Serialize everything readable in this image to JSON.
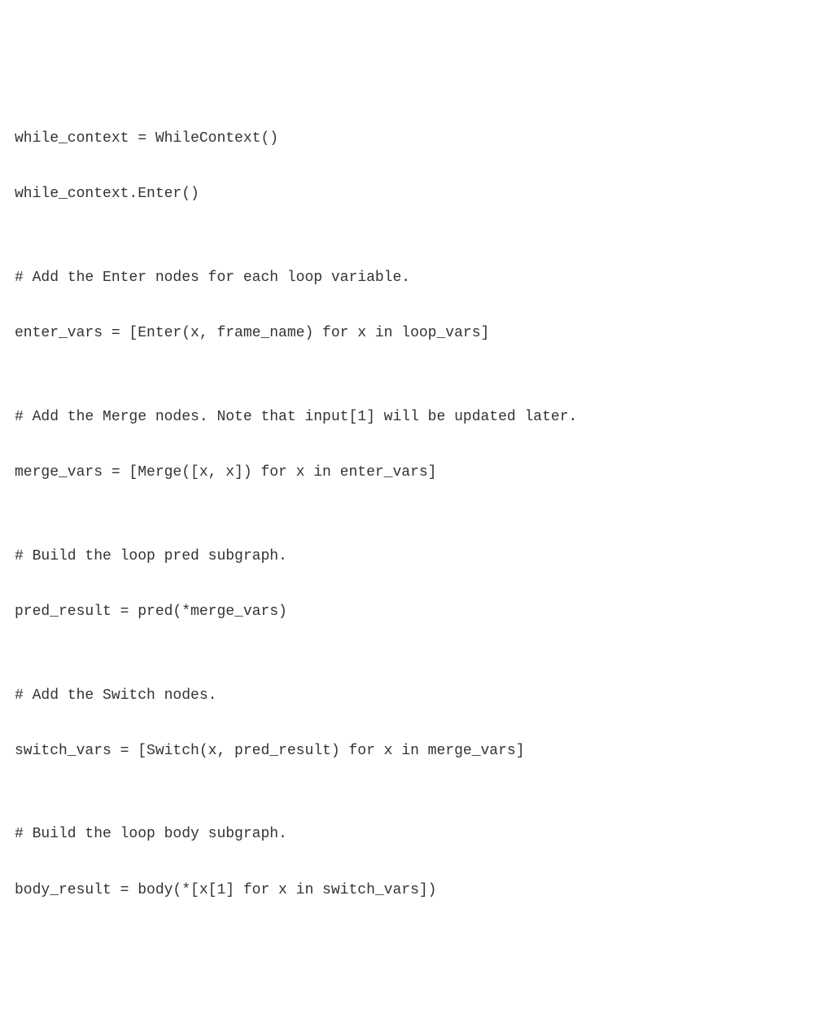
{
  "lines": [
    "while_context = WhileContext()",
    "while_context.Enter()",
    "",
    "# Add the Enter nodes for each loop variable.",
    "enter_vars = [Enter(x, frame_name) for x in loop_vars]",
    "",
    "# Add the Merge nodes. Note that input[1] will be updated later.",
    "merge_vars = [Merge([x, x]) for x in enter_vars]",
    "",
    "# Build the loop pred subgraph.",
    "pred_result = pred(*merge_vars)",
    "",
    "# Add the Switch nodes.",
    "switch_vars = [Switch(x, pred_result) for x in merge_vars]",
    "",
    "# Build the loop body subgraph.",
    "body_result = body(*[x[1] for x in switch_vars])"
  ]
}
